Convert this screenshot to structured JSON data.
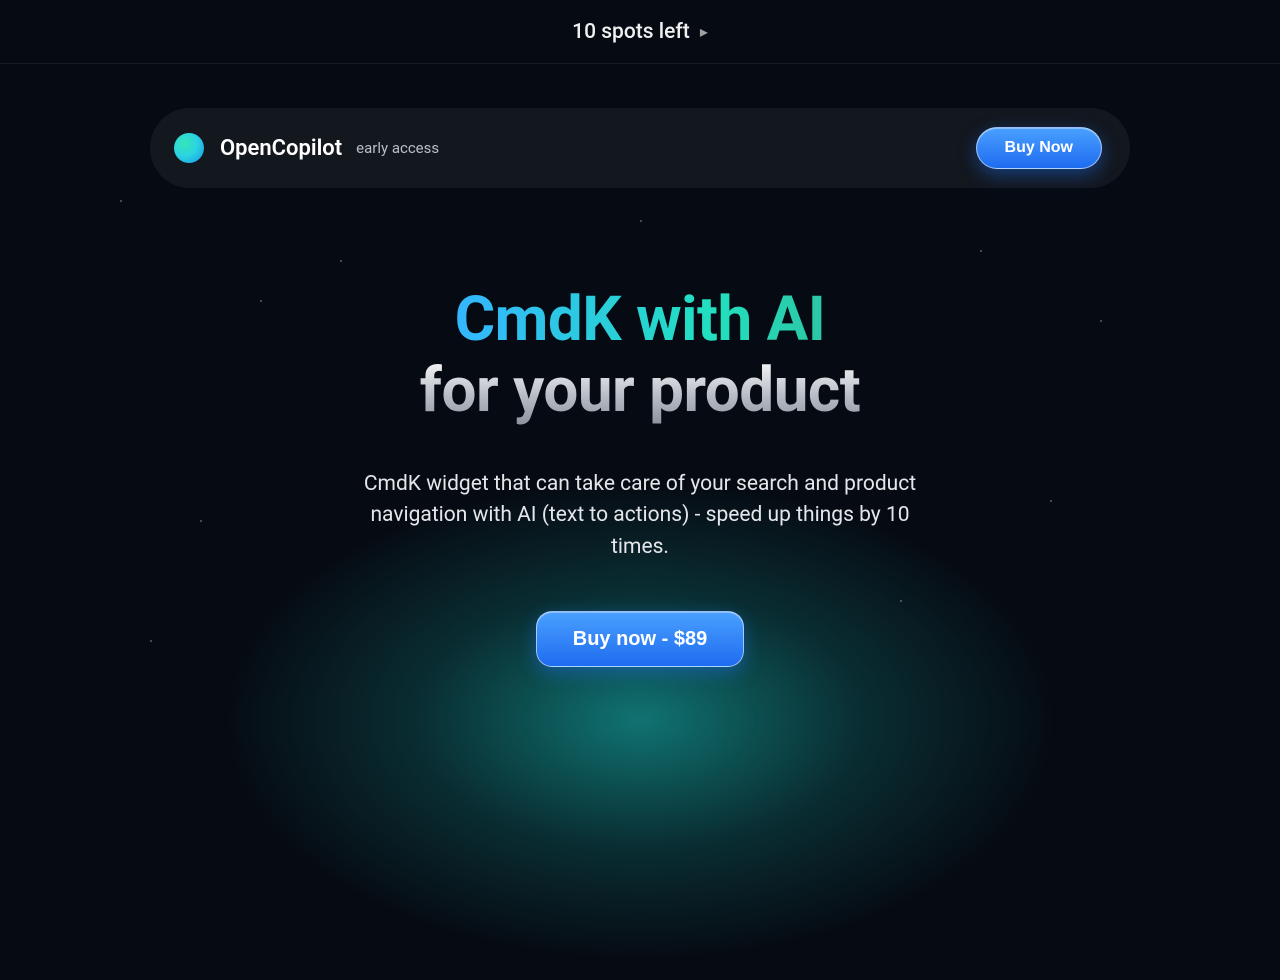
{
  "topbar": {
    "text": "10 spots left"
  },
  "nav": {
    "brand": "OpenCopilot",
    "badge": "early access",
    "buy_label": "Buy Now"
  },
  "hero": {
    "headline_line1": "CmdK with AI",
    "headline_line2": "for your product",
    "sub": "CmdK widget that can take care of your search and product navigation with AI (text to actions) - speed up things by 10 times.",
    "cta_label": "Buy now - $89"
  }
}
